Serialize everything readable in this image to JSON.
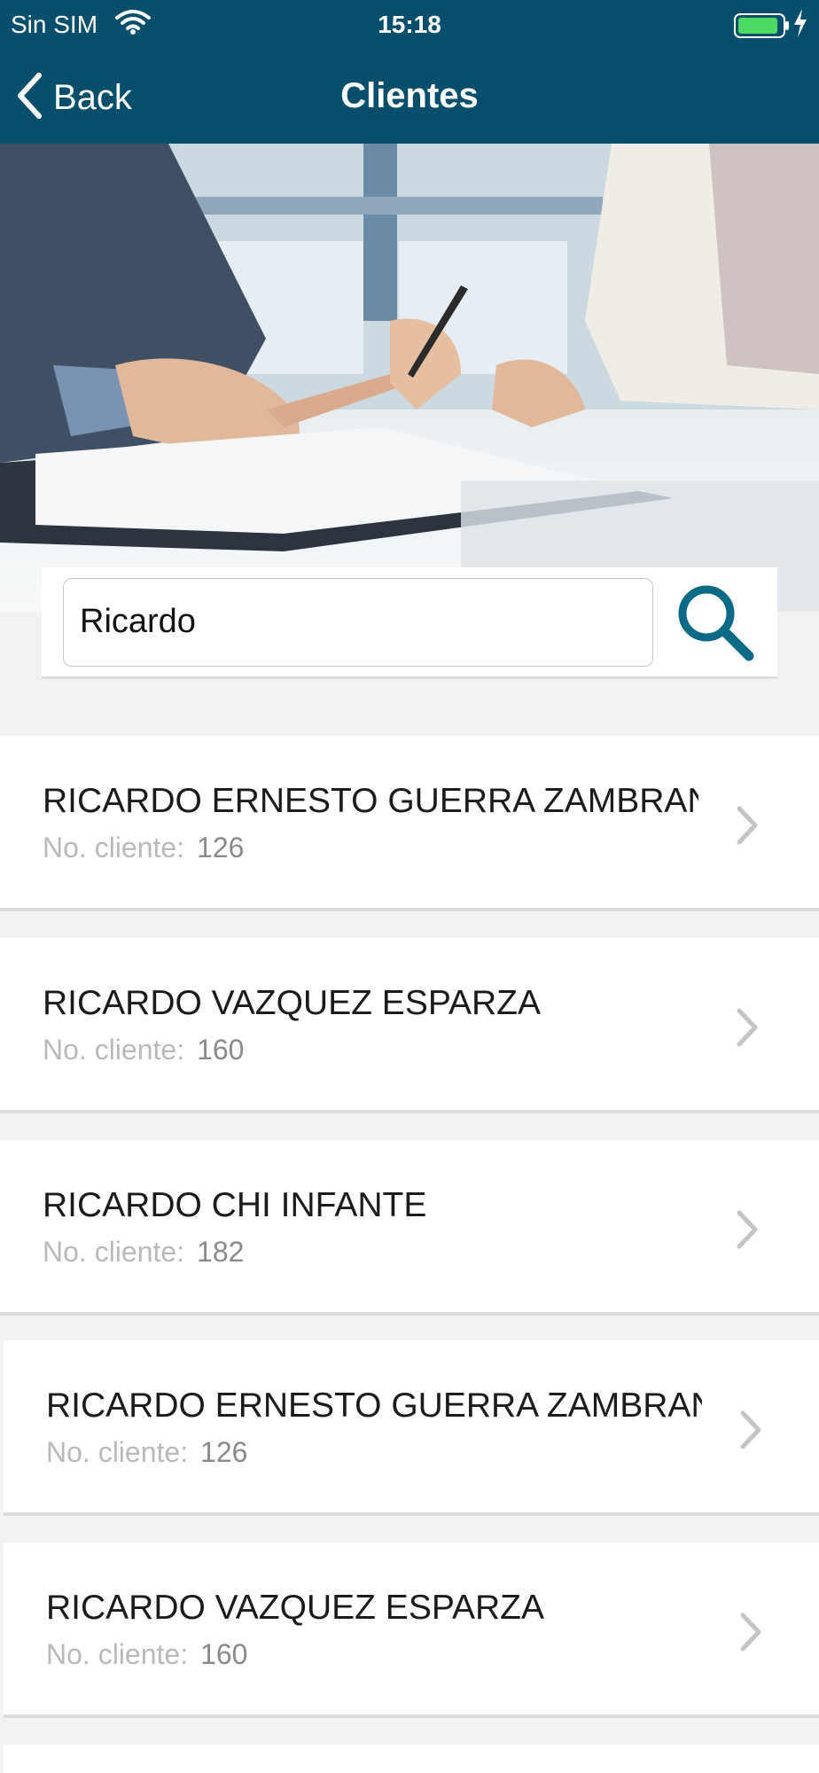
{
  "status_bar": {
    "carrier": "Sin SIM",
    "time": "15:18"
  },
  "nav": {
    "back_label": "Back",
    "title": "Clientes"
  },
  "search": {
    "value": "Ricardo"
  },
  "client_label": "No. cliente:",
  "clients": [
    {
      "name": "RICARDO ERNESTO GUERRA ZAMBRANO",
      "number": "126"
    },
    {
      "name": "RICARDO VAZQUEZ ESPARZA",
      "number": "160"
    },
    {
      "name": "RICARDO CHI INFANTE",
      "number": "182"
    },
    {
      "name": "RICARDO ERNESTO GUERRA ZAMBRANO",
      "number": "126"
    },
    {
      "name": "RICARDO VAZQUEZ ESPARZA",
      "number": "160"
    }
  ],
  "colors": {
    "header": "#064f6c",
    "accent": "#0b6b86",
    "battery": "#4cd964"
  },
  "icons": [
    "wifi-icon",
    "battery-icon",
    "chevron-left-icon",
    "search-icon",
    "chevron-right-icon"
  ]
}
